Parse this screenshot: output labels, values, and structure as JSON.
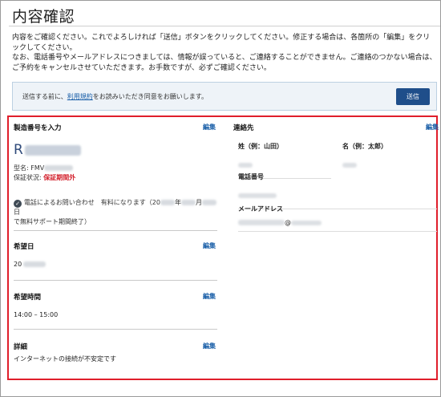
{
  "page": {
    "title": "内容確認",
    "intro_line1": "内容をご確認ください。これでよろしければ「送信」ボタンをクリックしてください。修正する場合は、各箇所の「編集」をクリックしてください。",
    "intro_line2": "なお、電話番号やメールアドレスにつきましては、情報が誤っていると、ご連絡することができません。ご連絡のつかない場合は、ご予約をキャンセルさせていただきます。お手数ですが、必ずご確認ください。"
  },
  "notice": {
    "text_before": "送信する前に、",
    "link": "利用規約",
    "text_after": "をお読みいただき同意をお願いします。",
    "send_label": "送信"
  },
  "product": {
    "section_label": "製造番号を入力",
    "edit_label": "編集",
    "serial_prefix": "R",
    "model_prefix": "型名: FMV",
    "warranty_label": "保証状況: ",
    "warranty_value": "保証期間外",
    "support_text_a": "電話によるお問い合わせ　有料になります（20",
    "support_text_b": "年",
    "support_text_c": "月",
    "support_text_d": "日",
    "support_text_e": "で無料サポート期間終了）"
  },
  "date": {
    "label": "希望日",
    "edit_label": "編集",
    "value_prefix": "20"
  },
  "time": {
    "label": "希望時間",
    "edit_label": "編集",
    "value": "14:00 – 15:00"
  },
  "details": {
    "label": "詳細",
    "edit_label": "編集",
    "value": "インターネットの接続が不安定です"
  },
  "contact": {
    "section_label": "連絡先",
    "edit_label": "編集",
    "last_name_label": "姓（例：山田）",
    "first_name_label": "名（例：太郎）",
    "phone_label": "電話番号",
    "email_label": "メールアドレス",
    "email_at": "@"
  },
  "colors": {
    "highlight_border": "#e01e2b",
    "link": "#1a5fa8",
    "button": "#1f4e8a",
    "warning": "#d21f2b"
  }
}
